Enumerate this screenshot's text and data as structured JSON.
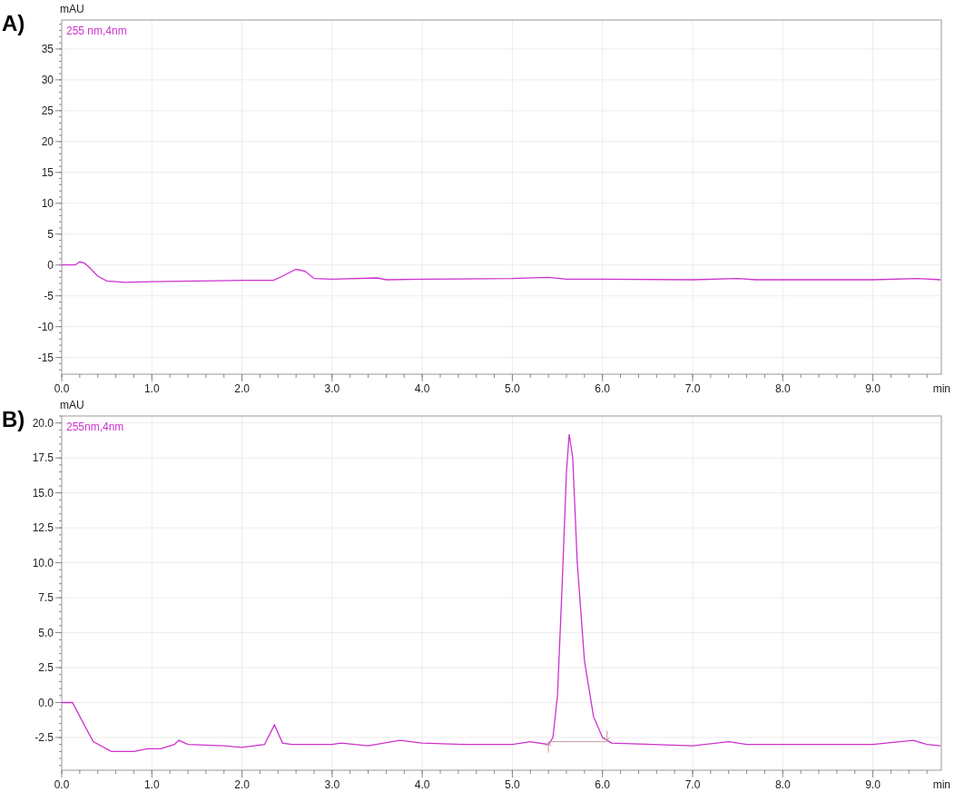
{
  "panels": [
    {
      "label": "A)",
      "chart_data": {
        "type": "line",
        "xlabel": "min",
        "ylabel": "mAU",
        "xlim": [
          0,
          9.76
        ],
        "ylim": [
          -17.7,
          39.7
        ],
        "grid": true,
        "xticks": [
          {
            "value": 0,
            "label": "0.0"
          },
          {
            "value": 1,
            "label": "1.0"
          },
          {
            "value": 2,
            "label": "2.0"
          },
          {
            "value": 3,
            "label": "3.0"
          },
          {
            "value": 4,
            "label": "4.0"
          },
          {
            "value": 5,
            "label": "5.0"
          },
          {
            "value": 6,
            "label": "6.0"
          },
          {
            "value": 7,
            "label": "7.0"
          },
          {
            "value": 8,
            "label": "8.0"
          },
          {
            "value": 9,
            "label": "9.0"
          }
        ],
        "yticks": [
          -15,
          -10,
          -5,
          0,
          5,
          10,
          15,
          20,
          25,
          30,
          35
        ],
        "x": [
          0,
          0.15,
          0.2,
          0.25,
          0.3,
          0.4,
          0.5,
          0.7,
          1.0,
          1.5,
          2.0,
          2.35,
          2.45,
          2.6,
          2.7,
          2.8,
          3.0,
          3.5,
          3.6,
          4.0,
          5.0,
          5.4,
          5.6,
          6.0,
          7.0,
          7.5,
          7.7,
          8.0,
          9.0,
          9.5,
          9.75
        ],
        "series": [
          {
            "name": "255 nm,4nm",
            "color": "#cc33cc",
            "values": [
              0,
              0,
              0.5,
              0.3,
              -0.3,
              -1.8,
              -2.6,
              -2.8,
              -2.7,
              -2.6,
              -2.5,
              -2.5,
              -1.8,
              -0.7,
              -1.0,
              -2.2,
              -2.3,
              -2.1,
              -2.4,
              -2.3,
              -2.2,
              -2.0,
              -2.3,
              -2.3,
              -2.4,
              -2.2,
              -2.4,
              -2.4,
              -2.4,
              -2.2,
              -2.4
            ]
          }
        ]
      }
    },
    {
      "label": "B)",
      "chart_data": {
        "type": "line",
        "xlabel": "min",
        "ylabel": "mAU",
        "xlim": [
          0,
          9.76
        ],
        "ylim": [
          -4.84,
          20.5
        ],
        "grid": true,
        "xticks": [
          {
            "value": 0,
            "label": "0.0"
          },
          {
            "value": 1,
            "label": "1.0"
          },
          {
            "value": 2,
            "label": "2.0"
          },
          {
            "value": 3,
            "label": "3.0"
          },
          {
            "value": 4,
            "label": "4.0"
          },
          {
            "value": 5,
            "label": "5.0"
          },
          {
            "value": 6,
            "label": "6.0"
          },
          {
            "value": 7,
            "label": "7.0"
          },
          {
            "value": 8,
            "label": "8.0"
          },
          {
            "value": 9,
            "label": "9.0"
          }
        ],
        "yticks": [
          {
            "value": -2.5,
            "label": "-2.5"
          },
          {
            "value": 0,
            "label": "0.0"
          },
          {
            "value": 2.5,
            "label": "2.5"
          },
          {
            "value": 5,
            "label": "5.0"
          },
          {
            "value": 7.5,
            "label": "7.5"
          },
          {
            "value": 10,
            "label": "10.0"
          },
          {
            "value": 12.5,
            "label": "12.5"
          },
          {
            "value": 15,
            "label": "15.0"
          },
          {
            "value": 17.5,
            "label": "17.5"
          },
          {
            "value": 20,
            "label": "20.0"
          }
        ],
        "x": [
          0,
          0.12,
          0.2,
          0.35,
          0.55,
          0.8,
          0.95,
          1.1,
          1.25,
          1.3,
          1.4,
          1.8,
          2.0,
          2.25,
          2.36,
          2.45,
          2.55,
          3.0,
          3.1,
          3.4,
          3.75,
          4.0,
          4.5,
          5.0,
          5.2,
          5.4,
          5.45,
          5.5,
          5.55,
          5.6,
          5.63,
          5.67,
          5.72,
          5.8,
          5.9,
          6.0,
          6.05,
          6.1,
          7.0,
          7.4,
          7.6,
          8.0,
          9.0,
          9.45,
          9.6,
          9.75
        ],
        "series": [
          {
            "name": "255nm,4nm",
            "color": "#cc33cc",
            "values": [
              0,
              0,
              -1.0,
              -2.8,
              -3.5,
              -3.5,
              -3.3,
              -3.3,
              -3.0,
              -2.7,
              -3.0,
              -3.1,
              -3.2,
              -3.0,
              -1.6,
              -2.9,
              -3.0,
              -3.0,
              -2.9,
              -3.1,
              -2.7,
              -2.9,
              -3.0,
              -3.0,
              -2.8,
              -3.0,
              -2.5,
              0.5,
              8.0,
              16.5,
              19.2,
              17.5,
              10.0,
              3.0,
              -1.0,
              -2.5,
              -2.7,
              -2.9,
              -3.1,
              -2.8,
              -3.0,
              -3.0,
              -3.0,
              -2.7,
              -3.0,
              -3.1
            ]
          },
          {
            "color": "#c89a9a",
            "values": [
              null,
              null,
              null,
              null,
              null,
              null,
              null,
              null,
              null,
              null,
              null,
              null,
              null,
              null,
              null,
              null,
              null,
              null,
              null,
              null,
              null,
              null,
              null,
              null,
              null,
              -2.8,
              -2.8,
              -2.8,
              -2.8,
              -2.8,
              -2.8,
              -2.8,
              -2.8,
              -2.8,
              -2.8,
              -2.8,
              -2.8,
              null,
              null,
              null,
              null,
              null,
              null,
              null,
              null,
              null
            ]
          }
        ]
      }
    }
  ]
}
